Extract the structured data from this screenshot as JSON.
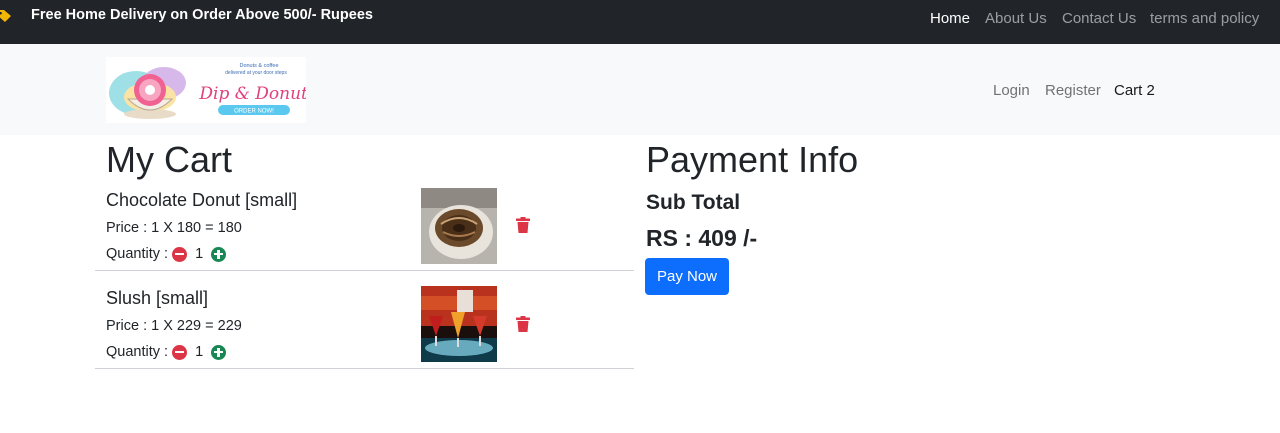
{
  "topbar": {
    "promo_icon": "tag-icon",
    "promo_text": "Free Home Delivery on Order Above 500/- Rupees",
    "nav": [
      "Home",
      "About Us",
      "Contact Us",
      "terms and policy"
    ]
  },
  "header": {
    "logo": {
      "tagline_1": "Donuts & coffee",
      "tagline_2": "delivered at your door steps",
      "brand": "Dip & Donuts",
      "cta": "ORDER NOW!"
    },
    "nav": [
      "Login",
      "Register",
      "Cart 2"
    ]
  },
  "cart": {
    "title": "My Cart",
    "qty_label": "Quantity :",
    "items": [
      {
        "name": "Chocolate Donut [small]",
        "price": "Price : 1 X 180 = 180",
        "qty": "1",
        "image": "chocolate-donut-photo"
      },
      {
        "name": "Slush [small]",
        "price": "Price : 1 X 229 = 229",
        "qty": "1",
        "image": "slush-drinks-photo"
      }
    ]
  },
  "payment": {
    "title": "Payment Info",
    "subtotal_label": "Sub Total",
    "total": "RS : 409 /-",
    "pay_button": "Pay Now"
  },
  "colors": {
    "topbar_bg": "#212529",
    "header_bg": "#f8f9fa",
    "primary": "#0d6efd",
    "danger": "#dc3545",
    "success": "#198754"
  }
}
